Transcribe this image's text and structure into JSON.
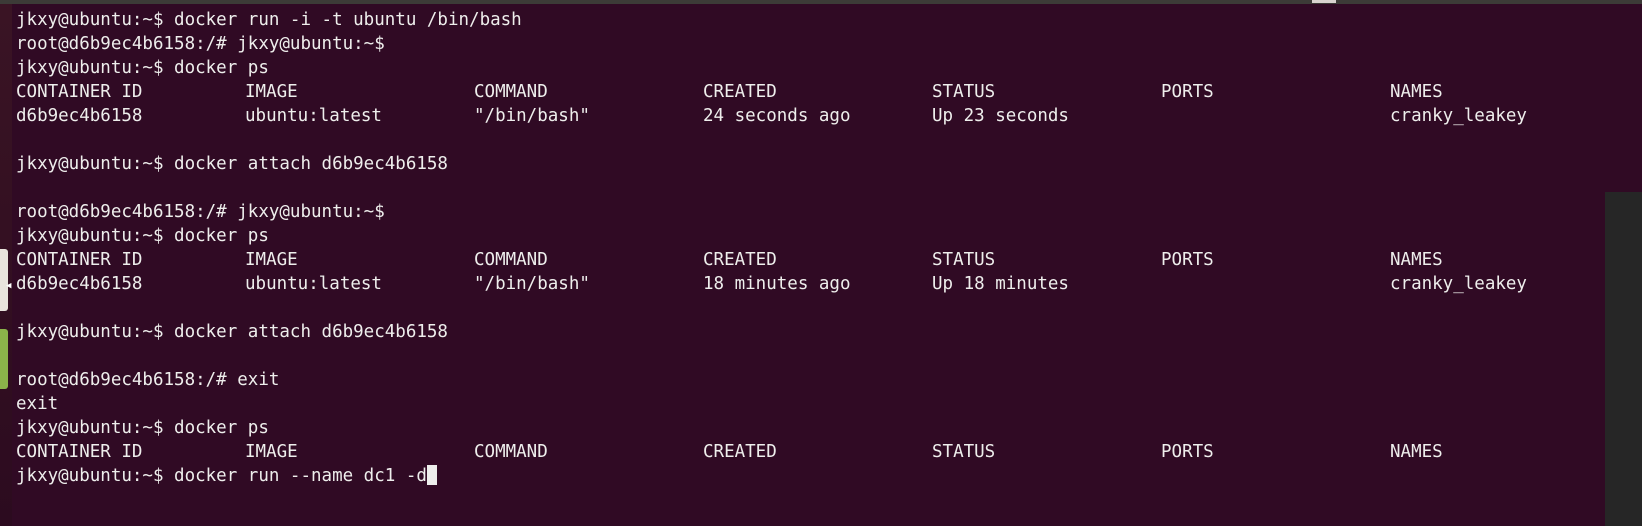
{
  "terminal": {
    "lines": [
      "jkxy@ubuntu:~$ docker run -i -t ubuntu /bin/bash",
      "root@d6b9ec4b6158:/# jkxy@ubuntu:~$",
      "jkxy@ubuntu:~$ docker ps",
      "",
      "",
      "",
      "jkxy@ubuntu:~$ docker attach d6b9ec4b6158",
      "",
      "root@d6b9ec4b6158:/# jkxy@ubuntu:~$",
      "jkxy@ubuntu:~$ docker ps",
      "",
      "",
      "",
      "jkxy@ubuntu:~$ docker attach d6b9ec4b6158",
      "",
      "root@d6b9ec4b6158:/# exit",
      "exit",
      "jkxy@ubuntu:~$ docker ps",
      "",
      "jkxy@ubuntu:~$ docker run --name dc1 -d"
    ],
    "header": {
      "container_id": "CONTAINER ID",
      "image": "IMAGE",
      "command": "COMMAND",
      "created": "CREATED",
      "status": "STATUS",
      "ports": "PORTS",
      "names": "NAMES"
    },
    "row1": {
      "container_id": "d6b9ec4b6158",
      "image": "ubuntu:latest",
      "command": "\"/bin/bash\"",
      "created": "24 seconds ago",
      "status": "Up 23 seconds",
      "ports": "",
      "names": "cranky_leakey"
    },
    "row2": {
      "container_id": "d6b9ec4b6158",
      "image": "ubuntu:latest",
      "command": "\"/bin/bash\"",
      "created": "18 minutes ago",
      "status": "Up 18 minutes",
      "ports": "",
      "names": "cranky_leakey"
    }
  },
  "colors": {
    "background": "#300a24",
    "foreground": "#eeeeec",
    "launcher_active": "#8bb34a"
  }
}
